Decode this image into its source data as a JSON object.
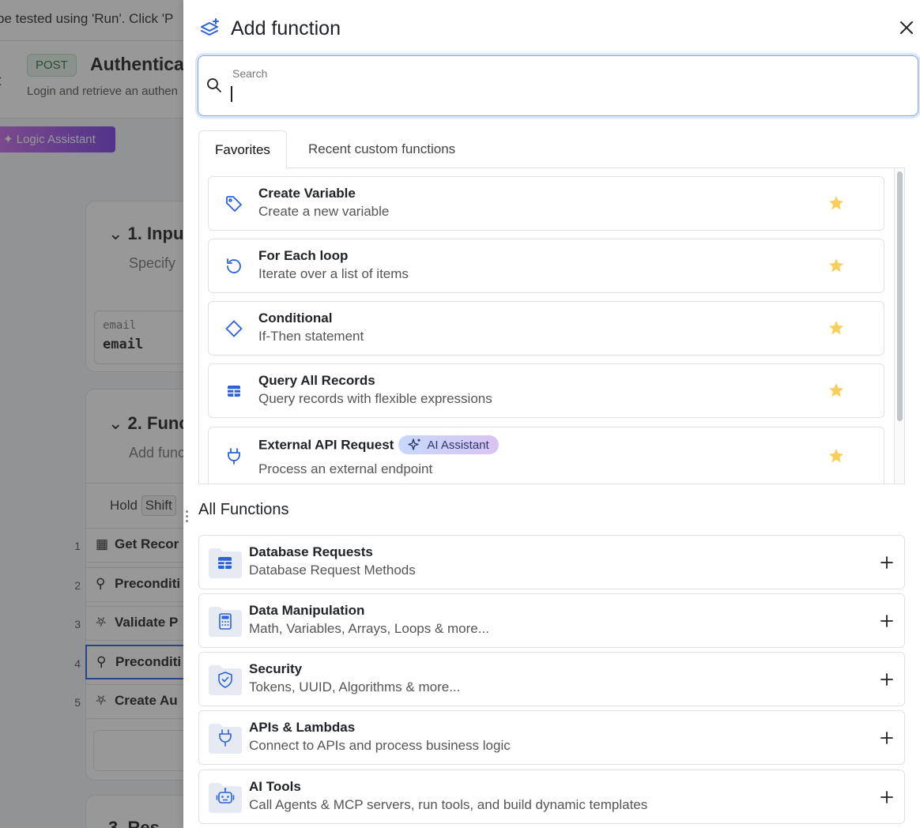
{
  "background": {
    "banner_text": "be tested using 'Run'. Click 'P",
    "method": "POST",
    "endpoint_title": "Authentica",
    "endpoint_subtitle": "Login and retrieve an authen",
    "logic_assistant_label": "Logic Assistant",
    "section1_title": "1. Inpu",
    "section1_sub": "Specify",
    "input_label": "email",
    "input_value": "email",
    "section2_title": "2. Func",
    "section2_sub": "Add func",
    "hold_text": "Hold",
    "shift_key": "Shift",
    "section3_title": "3. Res",
    "steps": [
      {
        "num": "1",
        "label": "Get Recor",
        "icon": "table-icon"
      },
      {
        "num": "2",
        "label": "Preconditi",
        "icon": "lock-icon"
      },
      {
        "num": "3",
        "label": "Validate P",
        "icon": "shield-check-icon"
      },
      {
        "num": "4",
        "label": "Preconditi",
        "icon": "lock-icon"
      },
      {
        "num": "5",
        "label": "Create Au",
        "icon": "shield-check-icon"
      }
    ]
  },
  "panel": {
    "title": "Add function",
    "search": {
      "label": "Search",
      "value": ""
    },
    "tabs": [
      {
        "label": "Favorites",
        "active": true
      },
      {
        "label": "Recent custom functions",
        "active": false
      }
    ],
    "favorites": [
      {
        "title": "Create Variable",
        "desc": "Create a new variable",
        "icon": "tag-icon"
      },
      {
        "title": "For Each loop",
        "desc": "Iterate over a list of items",
        "icon": "loop-icon"
      },
      {
        "title": "Conditional",
        "desc": "If-Then statement",
        "icon": "diamond-icon"
      },
      {
        "title": "Query All Records",
        "desc": "Query records with flexible expressions",
        "icon": "table-icon"
      },
      {
        "title": "External API Request",
        "desc": "Process an external endpoint",
        "icon": "plug-icon",
        "badge": "AI Assistant"
      }
    ],
    "all_functions_title": "All Functions",
    "categories": [
      {
        "title": "Database Requests",
        "desc": "Database Request Methods",
        "icon": "database-table-icon"
      },
      {
        "title": "Data Manipulation",
        "desc": "Math, Variables, Arrays, Loops & more...",
        "icon": "calculator-icon"
      },
      {
        "title": "Security",
        "desc": "Tokens, UUID, Algorithms & more...",
        "icon": "shield-check-icon"
      },
      {
        "title": "APIs & Lambdas",
        "desc": "Connect to APIs and process business logic",
        "icon": "plug-icon"
      },
      {
        "title": "AI Tools",
        "desc": "Call Agents & MCP servers, run tools, and build dynamic templates",
        "icon": "robot-icon"
      }
    ]
  },
  "colors": {
    "accent": "#2b62d9",
    "star": "#f7cf5a",
    "folder": "#e6eaf2",
    "method_bg": "#e6f3ea"
  }
}
